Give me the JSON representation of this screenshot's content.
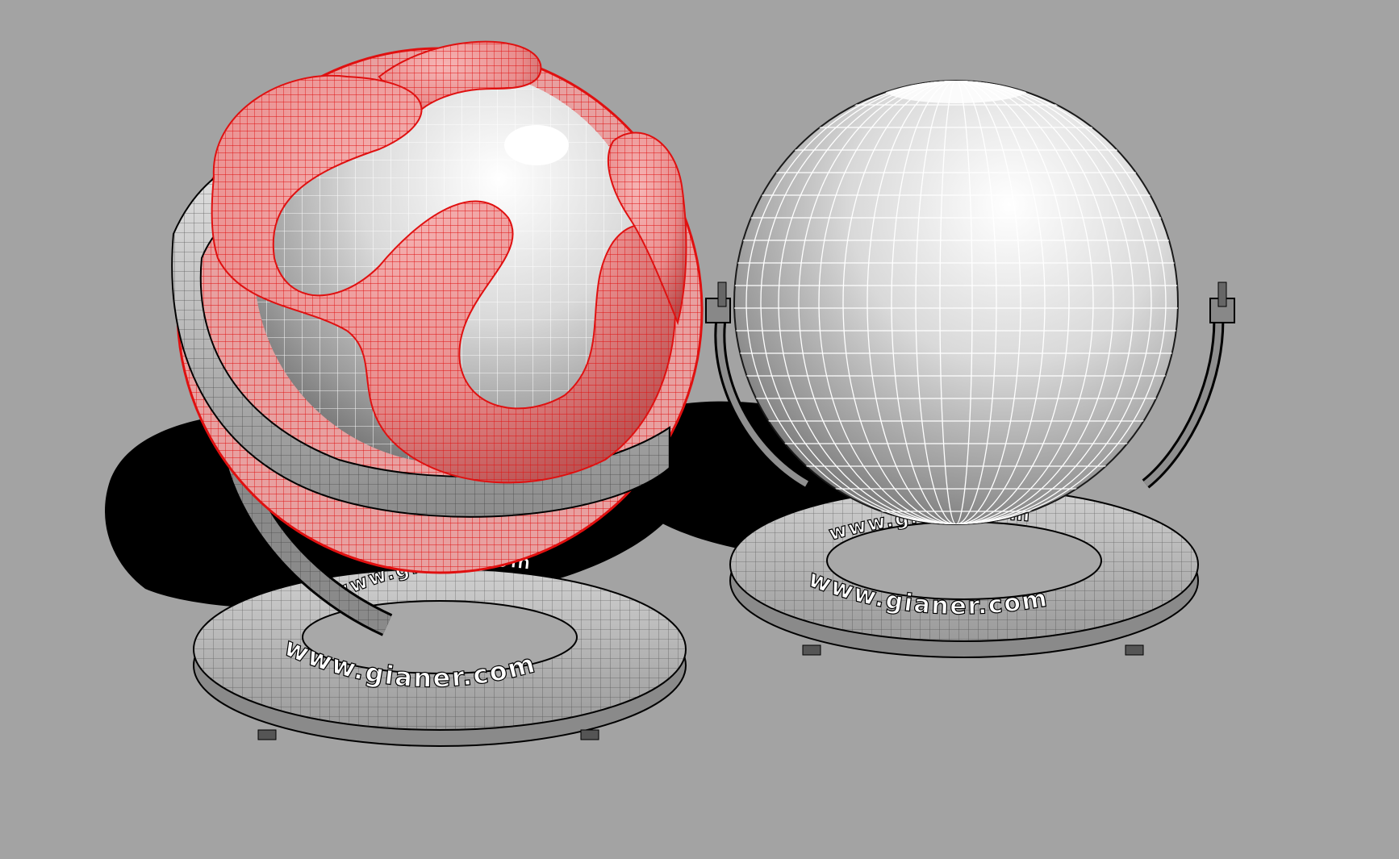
{
  "viewport": {
    "background_color": "#a3a3a3",
    "wire_color": "#000000",
    "selection_color": "#ff0000"
  },
  "objects": [
    {
      "name": "shaderball-left",
      "selected": true,
      "base_text_front": "www.gianer.com",
      "base_text_back": "www.gianer.com"
    },
    {
      "name": "shaderball-right",
      "selected": false,
      "base_text_front": "www.gianer.com",
      "base_text_back": "www.gianer.com"
    }
  ]
}
